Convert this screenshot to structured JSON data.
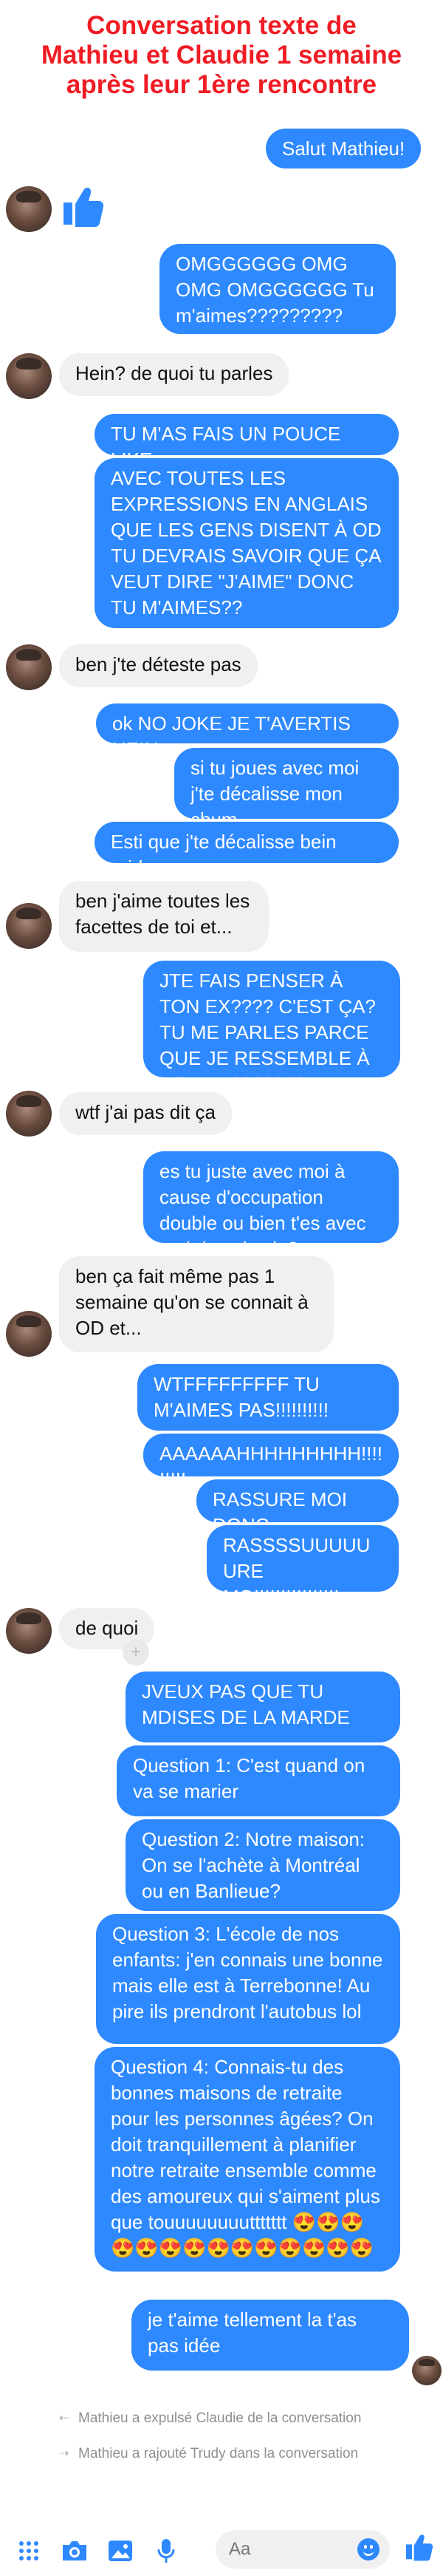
{
  "title": {
    "line1": "Conversation texte de",
    "line2": "Mathieu et Claudie 1 semaine",
    "line3": "après leur 1ère rencontre"
  },
  "messages": {
    "m1": "Salut Mathieu!",
    "m2": "OMGGGGGG OMG OMG OMGGGGGG Tu m'aimes?????????",
    "m3": "Hein? de quoi tu parles",
    "m4": "TU M'AS FAIS UN POUCE LIKE",
    "m5": "AVEC TOUTES LES EXPRESSIONS EN ANGLAIS QUE LES GENS DISENT À OD TU DEVRAIS SAVOIR QUE ÇA VEUT DIRE \"J'AIME\" DONC TU M'AIMES??",
    "m6": "ben j'te déteste pas",
    "m7": "ok NO JOKE JE T'AVERTIS HEIN",
    "m8": "si tu joues avec moi j'te décalisse mon chum",
    "m9": "Esti que j'te décalisse bein raide",
    "m10": "ben j'aime toutes les facettes de toi et...",
    "m11": "JTE FAIS PENSER À TON EX???? C'EST ÇA? TU ME PARLES PARCE QUE JE RESSEMBLE À TON EX???????",
    "m12": "wtf j'ai pas dit ça",
    "m13": "es tu juste avec moi à cause d'occupation double ou bien t'es avec moi dans la vie?",
    "m14": "ben ça fait même pas 1 semaine qu'on se connait à OD et...",
    "m15": "WTFFFFFFFFF TU M'AIMES PAS!!!!!!!!!!",
    "m16": "AAAAAAHHHHHHHHH!!!!!!!!!",
    "m17": "RASSURE MOI DONC",
    "m18": "RASSSSUUUUUURE MOIIIIIII!!!!!!!!!",
    "m19": "de quoi",
    "m20": "JVEUX PAS QUE TU MDISES DE LA MARDE",
    "m21": "Question 1: C'est quand on va se marier",
    "m22": "Question 2: Notre maison: On se l'achète à Montréal ou en Banlieue?",
    "m23": "Question 3: L'école de nos enfants: j'en connais une bonne mais elle est à Terrebonne! Au pire ils prendront l'autobus lol",
    "m24": "Question 4: Connais-tu des bonnes maisons de retraite pour les personnes âgées? On doit tranquillement à planifier notre retraite ensemble comme des amoureux qui s'aiment plus que touuuuuuuuttttttt 😍😍😍 😍😍😍😍😍😍😍😍😍😍😍",
    "m25": "je t'aime tellement la t'as pas idée"
  },
  "system": {
    "s1": "Mathieu a expulsé Claudie de la conversation",
    "s2": "Mathieu a rajouté Trudy dans la conversation"
  },
  "composer": {
    "placeholder": "Aa"
  },
  "icons": {
    "thumb": "thumbs-up-icon",
    "grid": "grid-icon",
    "camera": "camera-icon",
    "image": "image-icon",
    "mic": "microphone-icon",
    "emoji": "emoji-icon",
    "like": "like-icon"
  },
  "colors": {
    "accent": "#2e89ff",
    "title": "#ef1c24",
    "incoming": "#f0f0f0"
  }
}
